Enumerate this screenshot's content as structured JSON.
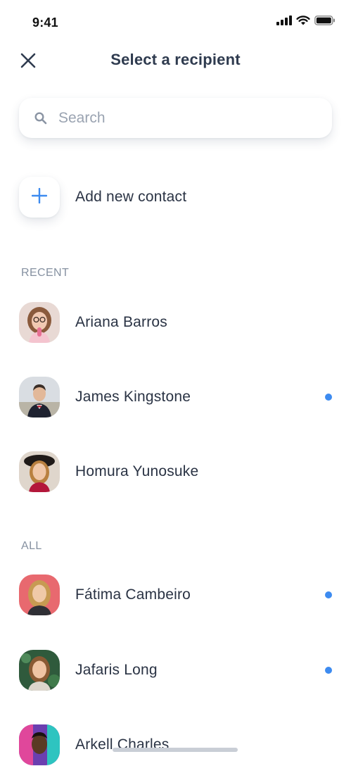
{
  "status_bar": {
    "time": "9:41"
  },
  "header": {
    "title": "Select a recipient"
  },
  "search": {
    "placeholder": "Search",
    "value": ""
  },
  "add_contact": {
    "label": "Add new contact"
  },
  "sections": {
    "recent": {
      "label": "RECENT",
      "contacts": [
        {
          "name": "Ariana Barros",
          "unread": false
        },
        {
          "name": "James Kingstone",
          "unread": true
        },
        {
          "name": "Homura Yunosuke",
          "unread": false
        }
      ]
    },
    "all": {
      "label": "ALL",
      "contacts": [
        {
          "name": "Fátima Cambeiro",
          "unread": true
        },
        {
          "name": "Jafaris Long",
          "unread": true
        },
        {
          "name": "Arkell Charles",
          "unread": false
        }
      ]
    }
  },
  "colors": {
    "accent": "#3d8bf0",
    "title": "#2f3b4f",
    "muted": "#8691a1"
  },
  "icons": [
    "close-icon",
    "search-icon",
    "plus-icon",
    "signal-icon",
    "wifi-icon",
    "battery-icon"
  ]
}
